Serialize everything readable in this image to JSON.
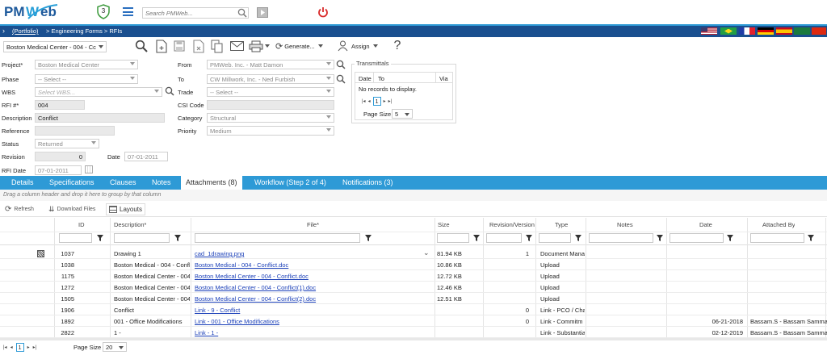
{
  "brand": {
    "logo": "PMWeb",
    "badge_count": "3"
  },
  "search": {
    "placeholder": "Search PMWeb..."
  },
  "breadcrumb": {
    "root": "(Portfolio)",
    "path": "> Engineering Forms > RFIs"
  },
  "toolbar": {
    "record": "Boston Medical Center - 004 - Cc",
    "generate": "Generate...",
    "assign": "Assign"
  },
  "form": {
    "project_label": "Project*",
    "project": "Boston Medical Center",
    "phase_label": "Phase",
    "phase": "-- Select --",
    "wbs_label": "WBS",
    "wbs_placeholder": "Select WBS...",
    "rfi_label": "RFI #*",
    "rfi": "004",
    "description_label": "Description",
    "description": "Conflict",
    "reference_label": "Reference",
    "reference": "",
    "status_label": "Status",
    "status": "Returned",
    "revision_label": "Revision",
    "revision": "0",
    "date_label": "Date",
    "date": "07-01-2011",
    "rfi_date_label": "RFI Date",
    "rfi_date": "07-01-2011",
    "from_label": "From",
    "from": "PMWeb. Inc. - Matt Damon",
    "to_label": "To",
    "to": "CW Millwork, Inc. - Ned Furbish",
    "trade_label": "Trade",
    "trade": "-- Select --",
    "csi_label": "CSI Code",
    "csi": "",
    "category_label": "Category",
    "category": "Structural",
    "priority_label": "Priority",
    "priority": "Medium"
  },
  "transmittals": {
    "title": "Transmittals",
    "cols": [
      "Date",
      "To",
      "Via"
    ],
    "empty": "No records to display.",
    "page": "1",
    "page_size_label": "Page Size",
    "page_size": "5"
  },
  "tabs": [
    "Details",
    "Specifications",
    "Clauses",
    "Notes",
    "Attachments (8)",
    "Workflow (Step 2 of 4)",
    "Notifications (3)"
  ],
  "group_hint": "Drag a column header and drop it here to group by that column",
  "grid_toolbar": {
    "refresh": "Refresh",
    "download": "Download Files",
    "layouts": "Layouts"
  },
  "columns": [
    "ID",
    "Description*",
    "File*",
    "Size",
    "Revision/Version",
    "Type",
    "Notes",
    "Date",
    "Attached By"
  ],
  "rows": [
    {
      "id": "1037",
      "desc": "Drawing 1",
      "file": "cad_1drawing.png",
      "size": "81.94 KB",
      "rev": "1",
      "type": "Document Mana",
      "date": "",
      "by": ""
    },
    {
      "id": "1038",
      "desc": "Boston Medical - 004 - Confl",
      "file": "Boston Medical - 004 - Conflict.doc",
      "size": "10.86 KB",
      "rev": "",
      "type": "Upload",
      "date": "",
      "by": ""
    },
    {
      "id": "1175",
      "desc": "Boston Medical Center - 004",
      "file": "Boston Medical Center - 004 - Conflict.doc",
      "size": "12.72 KB",
      "rev": "",
      "type": "Upload",
      "date": "",
      "by": ""
    },
    {
      "id": "1272",
      "desc": "Boston Medical Center - 004",
      "file": "Boston Medical Center - 004 - Conflict(1).doc",
      "size": "12.46 KB",
      "rev": "",
      "type": "Upload",
      "date": "",
      "by": ""
    },
    {
      "id": "1505",
      "desc": "Boston Medical Center - 004",
      "file": "Boston Medical Center - 004 - Conflict(2).doc",
      "size": "12.51 KB",
      "rev": "",
      "type": "Upload",
      "date": "",
      "by": ""
    },
    {
      "id": "1906",
      "desc": "Conflict",
      "file": "Link - 9 - Conflict",
      "size": "",
      "rev": "0",
      "type": "Link - PCO / Cha",
      "date": "",
      "by": ""
    },
    {
      "id": "1892",
      "desc": "001 - Office Modifications",
      "file": "Link - 001 - Office Modifications",
      "size": "",
      "rev": "0",
      "type": "Link - Commitm",
      "date": "06-21-2018",
      "by": "Bassam.S - Bassam Samman"
    },
    {
      "id": "2822",
      "desc": "1 -",
      "file": "Link - 1 -",
      "size": "",
      "rev": "",
      "type": "Link - Substantia",
      "date": "02-12-2019",
      "by": "Bassam.S - Bassam Samman"
    }
  ],
  "pager": {
    "page": "1",
    "size_label": "Page Size",
    "size": "20"
  },
  "colors": {
    "accent": "#2e9ad6",
    "nav": "#1a4f8f",
    "power": "#d92b2b"
  }
}
